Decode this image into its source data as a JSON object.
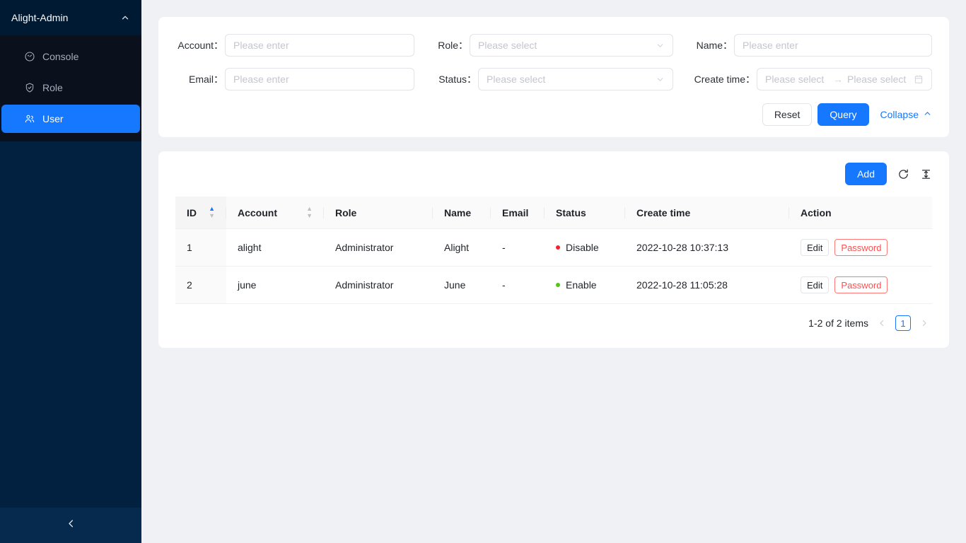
{
  "sidebar": {
    "title": "Alight-Admin",
    "collapse_caret": "caret-up-icon",
    "items": [
      {
        "label": "Console",
        "icon": "dashboard-icon",
        "active": false
      },
      {
        "label": "Role",
        "icon": "shield-check-icon",
        "active": false
      },
      {
        "label": "User",
        "icon": "team-icon",
        "active": true
      }
    ],
    "footer_icon": "chevron-left-icon"
  },
  "search": {
    "fields": [
      {
        "label": "Account：",
        "placeholder": "Please enter",
        "type": "input"
      },
      {
        "label": "Role：",
        "placeholder": "Please select",
        "type": "select"
      },
      {
        "label": "Name：",
        "placeholder": "Please enter",
        "type": "input"
      },
      {
        "label": "Email：",
        "placeholder": "Please enter",
        "type": "input"
      },
      {
        "label": "Status：",
        "placeholder": "Please select",
        "type": "select"
      },
      {
        "label": "Create time：",
        "placeholder_start": "Please select",
        "separator": "→",
        "placeholder_end": "Please select",
        "type": "daterange"
      }
    ],
    "reset_label": "Reset",
    "query_label": "Query",
    "collapse_label": "Collapse"
  },
  "toolbar": {
    "add_label": "Add",
    "reload_icon": "reload-icon",
    "density_icon": "column-height-icon"
  },
  "table": {
    "columns": [
      {
        "key": "id",
        "label": "ID",
        "sortable": true,
        "sort": "asc"
      },
      {
        "key": "account",
        "label": "Account",
        "sortable": true,
        "sort": "none"
      },
      {
        "key": "role",
        "label": "Role",
        "sortable": false
      },
      {
        "key": "name",
        "label": "Name",
        "sortable": false
      },
      {
        "key": "email",
        "label": "Email",
        "sortable": false
      },
      {
        "key": "status",
        "label": "Status",
        "sortable": false
      },
      {
        "key": "create_time",
        "label": "Create time",
        "sortable": false
      },
      {
        "key": "action",
        "label": "Action",
        "sortable": false
      }
    ],
    "rows": [
      {
        "id": "1",
        "account": "alight",
        "role": "Administrator",
        "name": "Alight",
        "email": "-",
        "status": "Disable",
        "status_color": "#f5222d",
        "create_time": "2022-10-28 10:37:13",
        "edit_label": "Edit",
        "password_label": "Password"
      },
      {
        "id": "2",
        "account": "june",
        "role": "Administrator",
        "name": "June",
        "email": "-",
        "status": "Enable",
        "status_color": "#52c41a",
        "create_time": "2022-10-28 11:05:28",
        "edit_label": "Edit",
        "password_label": "Password"
      }
    ]
  },
  "pagination": {
    "summary": "1-2 of 2 items",
    "prev_icon": "chevron-left-icon",
    "next_icon": "chevron-right-icon",
    "current_page": "1"
  },
  "colors": {
    "primary": "#1677ff",
    "danger": "#ff4d4f",
    "success": "#52c41a",
    "sidebar_bg": "#02203f",
    "sidebar_menu_bg": "#0a101c",
    "page_bg": "#f0f1f5"
  }
}
